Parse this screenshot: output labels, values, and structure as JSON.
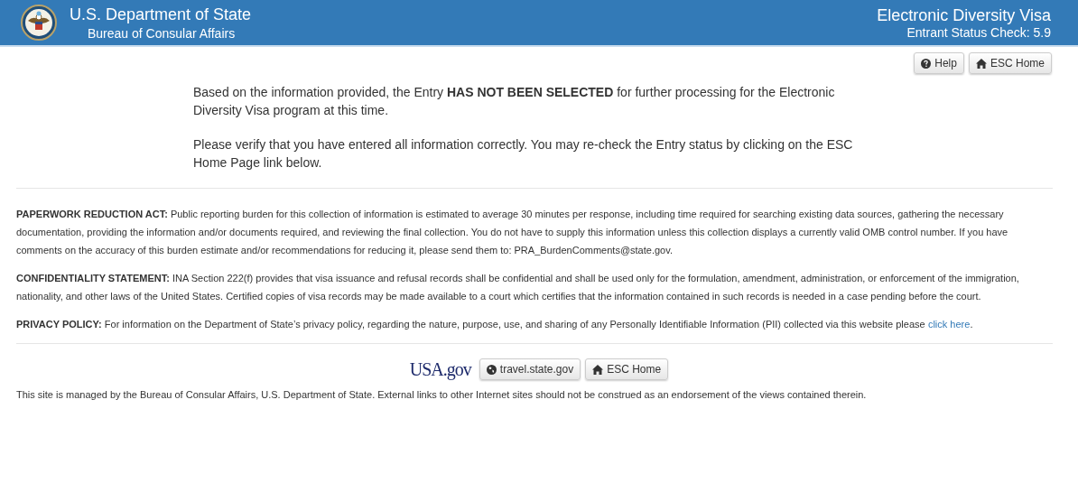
{
  "header": {
    "title": "U.S. Department of State",
    "subtitle": "Bureau of Consular Affairs",
    "app_title": "Electronic Diversity Visa",
    "app_subtitle": "Entrant Status Check: 5.9"
  },
  "top_buttons": [
    {
      "kind": "help",
      "label": "Help"
    },
    {
      "kind": "home",
      "label": "ESC Home"
    }
  ],
  "result": [
    "Based on the information provided, the Entry **HAS NOT BEEN SELECTED** for further processing for the Electronic Diversity Visa program at this time.",
    "Please verify that you have entered all information correctly. You may re-check the Entry status by clicking on the ESC Home Page link below."
  ],
  "notices": [
    {
      "text": "**PAPERWORK REDUCTION ACT:** Public reporting burden for this collection of information is estimated to average 30 minutes per response, including time required for searching existing data sources, gathering the necessary documentation, providing the information and/or documents required, and reviewing the final collection. You do not have to supply this information unless this collection displays a currently valid OMB control number. If you have comments on the accuracy of this burden estimate and/or recommendations for reducing it, please send them to: PRA_BurdenComments@state.gov."
    },
    {
      "text": "**CONFIDENTIALITY STATEMENT:** INA Section 222(f) provides that visa issuance and refusal records shall be confidential and shall be used only for the formulation, amendment, administration, or enforcement of the immigration, nationality, and other laws of the United States. Certified copies of visa records may be made available to a court which certifies that the information contained in such records is needed in a case pending before the court."
    },
    {
      "text": "**PRIVACY POLICY:** For information on the Department of State’s privacy policy, regarding the nature, purpose, use, and sharing of any Personally Identifiable Information (PII) collected via this website please",
      "link": "click here",
      "after": "."
    }
  ],
  "footer": {
    "logo": "USA.gov",
    "buttons": [
      {
        "kind": "globe",
        "label": "travel.state.gov"
      },
      {
        "kind": "home",
        "label": "ESC Home"
      }
    ],
    "note": "This site is managed by the Bureau of Consular Affairs, U.S. Department of State. External links to other Internet sites should not be construed as an endorsement of the views contained therein."
  }
}
